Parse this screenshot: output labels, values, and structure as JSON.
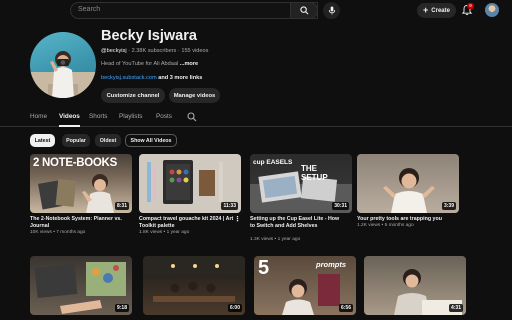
{
  "topbar": {
    "search_placeholder": "Search",
    "create_label": "Create",
    "notifications_count": "9"
  },
  "channel": {
    "name": "Becky Isjwara",
    "handle": "@beckyisj",
    "subscribers": "2.38K subscribers",
    "videos_count": "155 videos",
    "description": "Head of YouTube for Ali Abdaal",
    "more_label": "...more",
    "link": "beckyisj.substack.com",
    "more_links": "and 3 more links",
    "customize_label": "Customize channel",
    "manage_label": "Manage videos"
  },
  "tabs": [
    {
      "label": "Home",
      "active": false
    },
    {
      "label": "Videos",
      "active": true
    },
    {
      "label": "Shorts",
      "active": false
    },
    {
      "label": "Playlists",
      "active": false
    },
    {
      "label": "Posts",
      "active": false
    }
  ],
  "filters": [
    {
      "label": "Latest",
      "selected": true
    },
    {
      "label": "Popular",
      "selected": false
    },
    {
      "label": "Oldest",
      "selected": false
    },
    {
      "label": "Show All Videos",
      "selected": false
    }
  ],
  "videos": [
    {
      "title": "The 2-Notebook System: Planner vs. Journal",
      "views": "10K views",
      "age": "7 months ago",
      "duration": "8:31",
      "thumb_text": "2 NOTE-BOOKS"
    },
    {
      "title": "Compact travel gouache kit 2024 | Art Toolkit palette",
      "views": "1.8K views",
      "age": "1 year ago",
      "duration": "11:33",
      "thumb_text": ""
    },
    {
      "title": "Setting up the Cup Easel Lite - How to Switch and Add Shelves",
      "views": "1.3K views",
      "age": "1 year ago",
      "duration": "30:31",
      "thumb_text": "THE SETUP",
      "thumb_brand": "cup EASELS"
    },
    {
      "title": "Your pretty tools are trapping you",
      "views": "1.2K views",
      "age": "5 months ago",
      "duration": "3:39",
      "thumb_text": ""
    },
    {
      "title": "",
      "views": "",
      "age": "",
      "duration": "9:18",
      "thumb_text": ""
    },
    {
      "title": "",
      "views": "",
      "age": "",
      "duration": "6:00",
      "thumb_text": ""
    },
    {
      "title": "",
      "views": "",
      "age": "",
      "duration": "6:56",
      "thumb_text": "prompts",
      "thumb_number": "5"
    },
    {
      "title": "",
      "views": "",
      "age": "",
      "duration": "4:31",
      "thumb_text": ""
    }
  ],
  "colors": {
    "background": "#0f0f0f",
    "accent_link": "#3ea6ff",
    "badge_red": "#cc0000",
    "chip_bg": "#272727"
  }
}
